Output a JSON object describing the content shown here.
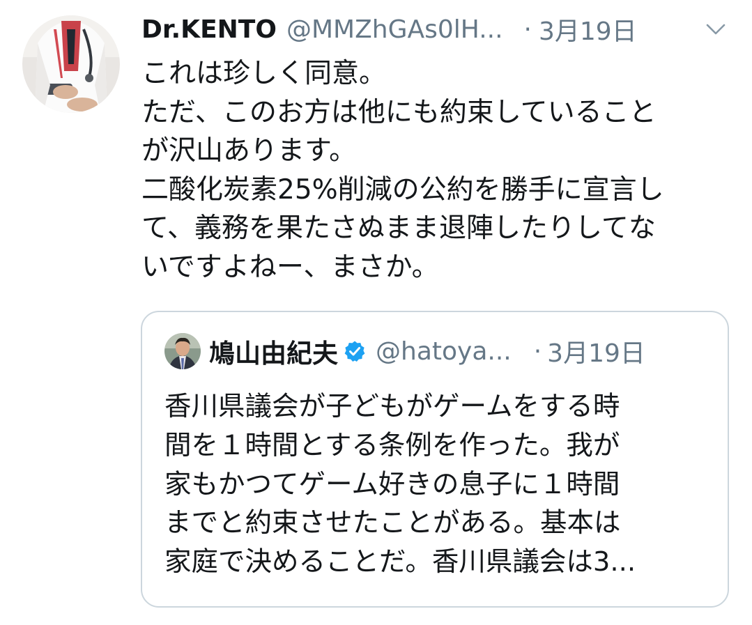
{
  "tweet": {
    "display_name": "Dr.KENTO",
    "handle": "@MMZhGAs0lH...",
    "separator": "·",
    "date": "3月19日",
    "avatar_icon": "doctor-avatar",
    "menu_icon": "chevron-down-icon",
    "body_lines": [
      "これは珍しく同意。",
      "ただ、このお方は他にも約束していること",
      "が沢山あります。",
      "二酸化炭素25%削減の公約を勝手に宣言し",
      "て、義務を果たさぬまま退陣したりしてな",
      "いですよねー、まさか。"
    ]
  },
  "quoted": {
    "display_name": "鳩山由紀夫",
    "verified": true,
    "verified_icon": "verified-badge-icon",
    "handle": "@hatoya...",
    "separator": "·",
    "date": "3月19日",
    "body_lines": [
      "香川県議会が子どもがゲームをする時",
      "間を１時間とする条例を作った。我が",
      "家もかつてゲーム好きの息子に１時間",
      "までと約束させたことがある。基本は",
      "家庭で決めることだ。香川県議会は3..."
    ]
  },
  "colors": {
    "text_primary": "#14171a",
    "text_secondary": "#657786",
    "border": "#ccd6dd",
    "verified_blue": "#1da1f2"
  }
}
